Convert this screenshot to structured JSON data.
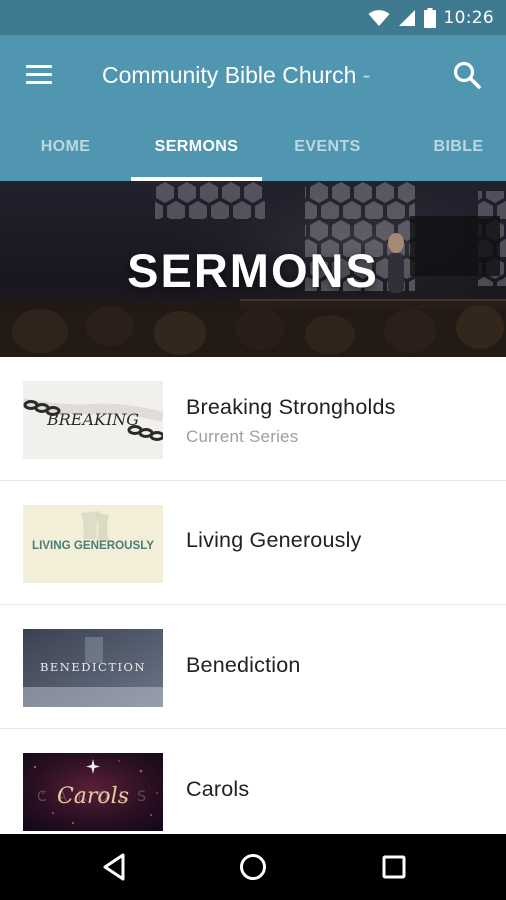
{
  "status_bar": {
    "time": "10:26",
    "icons": [
      "wifi-icon",
      "signal-icon",
      "battery-icon"
    ]
  },
  "app_bar": {
    "title": "Community Bible Church -",
    "menu_icon": "hamburger-menu-icon",
    "search_icon": "search-icon"
  },
  "tabs": [
    {
      "label": "HOME",
      "active": false
    },
    {
      "label": "SERMONS",
      "active": true
    },
    {
      "label": "EVENTS",
      "active": false
    },
    {
      "label": "BIBLE",
      "active": false
    }
  ],
  "hero": {
    "title": "SERMONS"
  },
  "sermons": [
    {
      "title": "Breaking Strongholds",
      "subtitle": "Current Series",
      "thumb_text": "BREAKING"
    },
    {
      "title": "Living Generously",
      "subtitle": "",
      "thumb_text": "LIVING GENEROUSLY"
    },
    {
      "title": "Benediction",
      "subtitle": "",
      "thumb_text": "BENEDICTION"
    },
    {
      "title": "Carols",
      "subtitle": "",
      "thumb_text": "Carols"
    }
  ],
  "nav_bar": {
    "icons": [
      "back-icon",
      "home-icon",
      "recents-icon"
    ]
  },
  "colors": {
    "status_bar": "#3f7a91",
    "app_bar": "#5196b0",
    "primary_text": "#212121",
    "secondary_text": "#9e9e9e"
  }
}
